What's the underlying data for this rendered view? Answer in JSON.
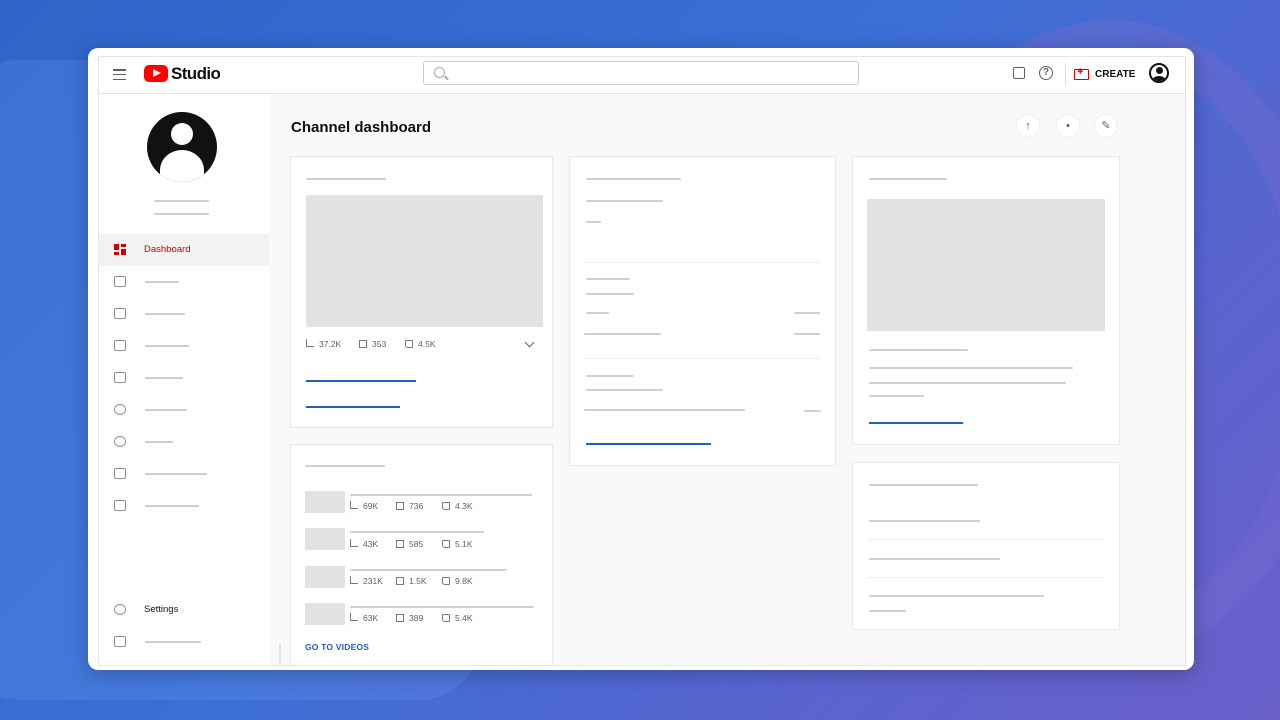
{
  "app": {
    "logo_text": "Studio"
  },
  "topbar": {
    "create_label": "CREATE"
  },
  "sidebar": {
    "items": [
      {
        "label": "Dashboard"
      },
      {
        "label": ""
      },
      {
        "label": ""
      },
      {
        "label": ""
      },
      {
        "label": ""
      },
      {
        "label": ""
      },
      {
        "label": ""
      },
      {
        "label": ""
      },
      {
        "label": ""
      }
    ],
    "settings_label": "Settings"
  },
  "main": {
    "title": "Channel dashboard",
    "latest_video": {
      "views": "37.2K",
      "comments": "353",
      "likes": "4.5K"
    },
    "videos": [
      {
        "views": "69K",
        "comments": "736",
        "likes": "4.3K"
      },
      {
        "views": "43K",
        "comments": "585",
        "likes": "5.1K"
      },
      {
        "views": "231K",
        "comments": "1.5K",
        "likes": "9.8K"
      },
      {
        "views": "63K",
        "comments": "389",
        "likes": "5.4K"
      }
    ],
    "go_to_videos": "GO TO VIDEOS"
  },
  "colors": {
    "accent_red": "#cc0000",
    "link_blue": "#1f5fbf",
    "background": "#3a6fd6"
  },
  "icons": {
    "menu": "hamburger-icon",
    "search": "search-icon",
    "feedback": "feedback-icon",
    "help": "help-icon",
    "create": "video-add-icon",
    "upload": "upload-icon",
    "live": "live-icon",
    "edit": "edit-icon",
    "settings": "gear-icon",
    "cursor": "mouse-cursor-icon"
  }
}
